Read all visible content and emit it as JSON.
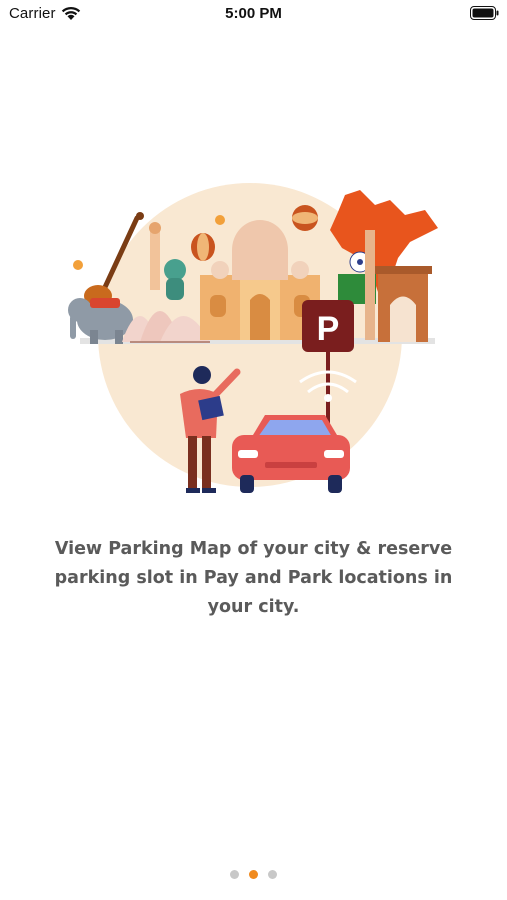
{
  "status_bar": {
    "carrier": "Carrier",
    "time": "5:00 PM",
    "icons": [
      "wifi-icon",
      "battery-icon"
    ]
  },
  "onboarding": {
    "description": "View Parking Map of your city & reserve parking slot in Pay and Park locations in your city.",
    "illustration_badge": "P",
    "page_count": 3,
    "active_page": 2
  },
  "colors": {
    "accent": "#f08a1e",
    "inactive_dot": "#c8c8c8",
    "text": "#5a5a5a",
    "car": "#e85a55",
    "parking_sign": "#7a1e1e"
  }
}
